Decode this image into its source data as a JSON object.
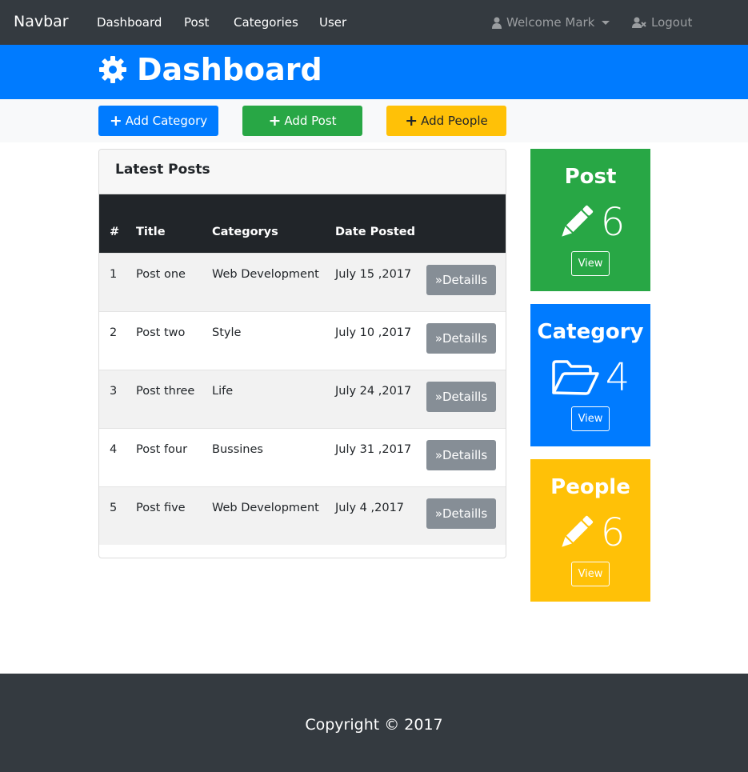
{
  "navbar": {
    "brand": "Navbar",
    "links": [
      "Dashboard",
      "Post",
      "Categories",
      "User"
    ],
    "welcome": "Welcome Mark",
    "logout": "Logout"
  },
  "header": {
    "icon": "gear-icon",
    "title": "Dashboard"
  },
  "actions": {
    "add_category": "Add Category",
    "add_post": "Add Post",
    "add_people": "Add People"
  },
  "latest_posts": {
    "title": "Latest Posts",
    "columns": [
      "#",
      "Title",
      "Categorys",
      "Date Posted"
    ],
    "details_label": "Detaills",
    "rows": [
      {
        "num": "1",
        "title": "Post one",
        "category": "Web Development",
        "date": "July 15 ,2017"
      },
      {
        "num": "2",
        "title": "Post two",
        "category": "Style",
        "date": "July 10 ,2017"
      },
      {
        "num": "3",
        "title": "Post three",
        "category": "Life",
        "date": "July 24 ,2017"
      },
      {
        "num": "4",
        "title": "Post four",
        "category": "Bussines",
        "date": "July 31 ,2017"
      },
      {
        "num": "5",
        "title": "Post five",
        "category": "Web Development",
        "date": "July 4 ,2017"
      }
    ]
  },
  "stats": [
    {
      "title": "Post",
      "count": "6",
      "icon": "pencil-icon",
      "view": "View",
      "color": "#28a745"
    },
    {
      "title": "Category",
      "count": "4",
      "icon": "folder-open-icon",
      "view": "View",
      "color": "#007bff"
    },
    {
      "title": "People",
      "count": "6",
      "icon": "pencil-icon",
      "view": "View",
      "color": "#ffc107"
    }
  ],
  "footer": {
    "copyright": "Copyright © 2017"
  }
}
